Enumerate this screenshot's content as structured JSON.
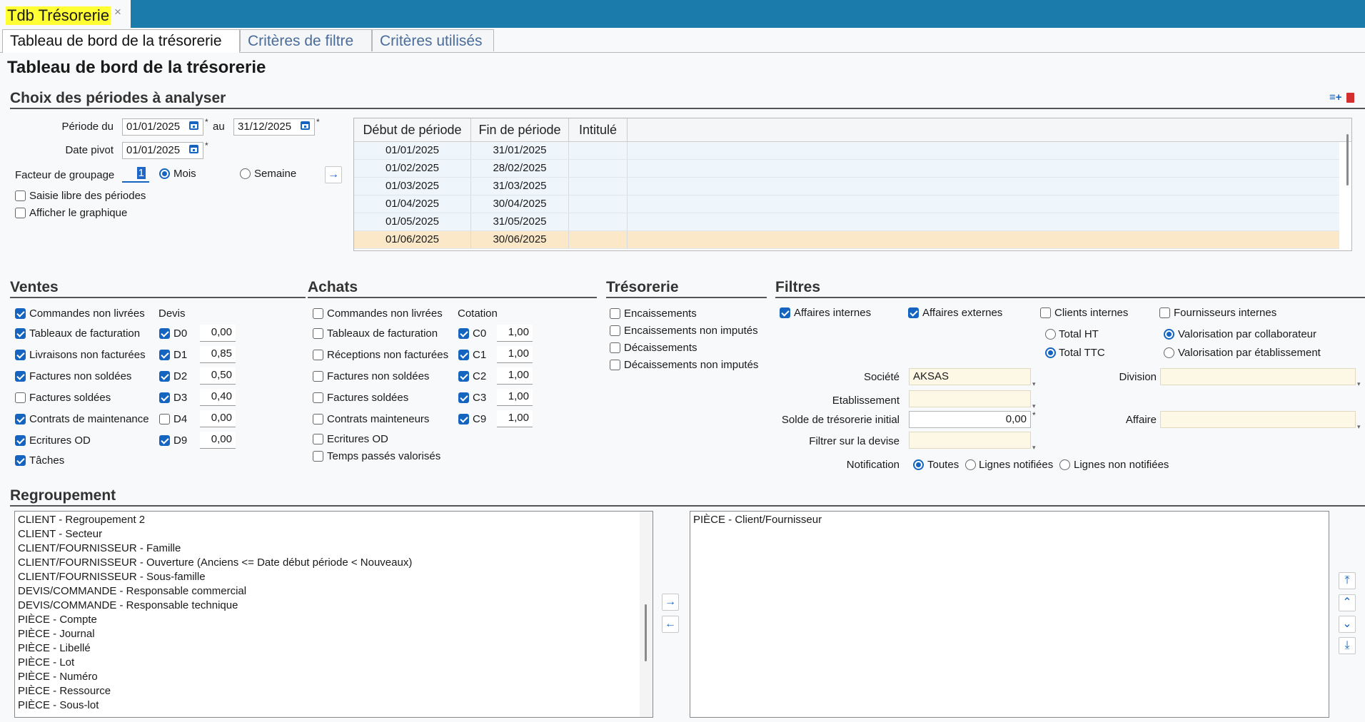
{
  "doc_tab": {
    "title": "Tdb Trésorerie",
    "close": "×"
  },
  "tabs": [
    "Tableau de bord de la trésorerie",
    "Critères de filtre",
    "Critères utilisés"
  ],
  "page_title": "Tableau de bord de la trésorerie",
  "periods": {
    "section_title": "Choix des périodes à analyser",
    "periode_du_label": "Période du",
    "periode_du_value": "01/01/2025",
    "au_label": "au",
    "au_value": "31/12/2025",
    "date_pivot_label": "Date pivot",
    "date_pivot_value": "01/01/2025",
    "facteur_label": "Facteur de groupage",
    "facteur_value": "1",
    "mois_label": "Mois",
    "semaine_label": "Semaine",
    "saisie_libre_label": "Saisie libre des périodes",
    "afficher_graphique_label": "Afficher le graphique",
    "required_mark": "*"
  },
  "period_grid": {
    "headers": [
      "Début de période",
      "Fin de période",
      "Intitulé"
    ],
    "rows": [
      [
        "01/01/2025",
        "31/01/2025",
        ""
      ],
      [
        "01/02/2025",
        "28/02/2025",
        ""
      ],
      [
        "01/03/2025",
        "31/03/2025",
        ""
      ],
      [
        "01/04/2025",
        "30/04/2025",
        ""
      ],
      [
        "01/05/2025",
        "31/05/2025",
        ""
      ],
      [
        "01/06/2025",
        "30/06/2025",
        ""
      ]
    ]
  },
  "ventes": {
    "title": "Ventes",
    "devis_label": "Devis",
    "items": [
      "Commandes non livrées",
      "Tableaux de facturation",
      "Livraisons non facturées",
      "Factures non soldées",
      "Factures soldées",
      "Contrats de maintenance",
      "Ecritures OD",
      "Tâches"
    ],
    "devis": [
      {
        "code": "D0",
        "value": "0,00"
      },
      {
        "code": "D1",
        "value": "0,85"
      },
      {
        "code": "D2",
        "value": "0,50"
      },
      {
        "code": "D3",
        "value": "0,40"
      },
      {
        "code": "D4",
        "value": "0,00"
      },
      {
        "code": "D9",
        "value": "0,00"
      }
    ]
  },
  "achats": {
    "title": "Achats",
    "cotation_label": "Cotation",
    "items": [
      "Commandes non livrées",
      "Tableaux de facturation",
      "Réceptions non facturées",
      "Factures non soldées",
      "Factures soldées",
      "Contrats mainteneurs",
      "Ecritures OD",
      "Temps passés valorisés"
    ],
    "cotations": [
      {
        "code": "C0",
        "value": "1,00"
      },
      {
        "code": "C1",
        "value": "1,00"
      },
      {
        "code": "C2",
        "value": "1,00"
      },
      {
        "code": "C3",
        "value": "1,00"
      },
      {
        "code": "C9",
        "value": "1,00"
      }
    ]
  },
  "tresorerie": {
    "title": "Trésorerie",
    "items": [
      "Encaissements",
      "Encaissements non imputés",
      "Décaissements",
      "Décaissements non imputés"
    ]
  },
  "filtres": {
    "title": "Filtres",
    "affaires_internes": "Affaires internes",
    "affaires_externes": "Affaires externes",
    "clients_internes": "Clients internes",
    "fournisseurs_internes": "Fournisseurs internes",
    "total_ht": "Total HT",
    "total_ttc": "Total TTC",
    "valo_collab": "Valorisation par collaborateur",
    "valo_etab": "Valorisation par établissement",
    "societe_label": "Société",
    "societe_value": "AKSAS",
    "division_label": "Division",
    "etablissement_label": "Etablissement",
    "solde_label": "Solde de trésorerie initial",
    "solde_value": "0,00",
    "affaire_label": "Affaire",
    "devise_label": "Filtrer sur la devise",
    "notification_label": "Notification",
    "toutes": "Toutes",
    "lignes_notifiees": "Lignes notifiées",
    "lignes_non_notifiees": "Lignes non notifiées"
  },
  "regroupement": {
    "title": "Regroupement",
    "available": [
      "CLIENT - Regroupement 2",
      "CLIENT - Secteur",
      "CLIENT/FOURNISSEUR - Famille",
      "CLIENT/FOURNISSEUR - Ouverture (Anciens <= Date début période < Nouveaux)",
      "CLIENT/FOURNISSEUR - Sous-famille",
      "DEVIS/COMMANDE - Responsable commercial",
      "DEVIS/COMMANDE - Responsable technique",
      "PIÈCE - Compte",
      "PIÈCE - Journal",
      "PIÈCE - Libellé",
      "PIÈCE - Lot",
      "PIÈCE - Numéro",
      "PIÈCE - Ressource",
      "PIÈCE - Sous-lot"
    ],
    "selected": [
      "PIÈCE - Client/Fournisseur"
    ]
  },
  "colors": {
    "accent": "#1565c0",
    "top_bar": "#1b7bab",
    "selection": "#fbe8c8",
    "highlight": "#ffff33"
  }
}
